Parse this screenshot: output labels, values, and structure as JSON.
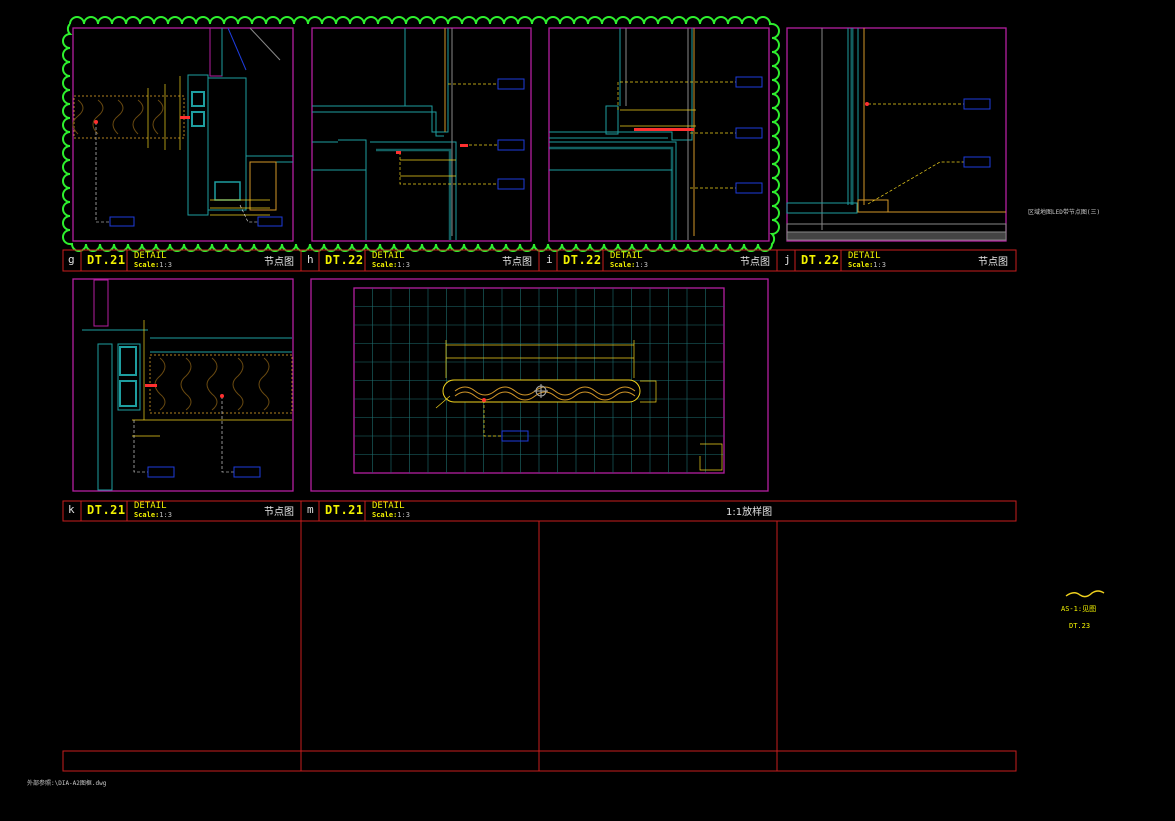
{
  "colors": {
    "background": "#000000",
    "frame_red": "#c81e1e",
    "viewport_magenta": "#b41ea0",
    "revision_cloud_green": "#2ef02e",
    "detail_cyan": "#1e9ea0",
    "dimension_yellow": "#f0d21e",
    "dimension_orange": "#d29628",
    "tag_blue": "#1e3cdc",
    "highlight_red": "#ff3030"
  },
  "details": [
    {
      "letter": "g",
      "ref": "DT.21",
      "detail": "DETAIL",
      "scale_label": "Scale:",
      "scale": "1:3",
      "name": "节点图"
    },
    {
      "letter": "h",
      "ref": "DT.22",
      "detail": "DETAIL",
      "scale_label": "Scale:",
      "scale": "1:3",
      "name": "节点图"
    },
    {
      "letter": "i",
      "ref": "DT.22",
      "detail": "DETAIL",
      "scale_label": "Scale:",
      "scale": "1:3",
      "name": "节点图"
    },
    {
      "letter": "j",
      "ref": "DT.22",
      "detail": "DETAIL",
      "scale_label": "Scale:",
      "scale": "1:3",
      "name": "节点图"
    },
    {
      "letter": "k",
      "ref": "DT.21",
      "detail": "DETAIL",
      "scale_label": "Scale:",
      "scale": "1:3",
      "name": "节点图"
    },
    {
      "letter": "m",
      "ref": "DT.21",
      "detail": "DETAIL",
      "scale_label": "Scale:",
      "scale": "1:3",
      "name": "1:1放样图"
    }
  ],
  "notes": {
    "side_note": "区域地图LED带节点图(三)",
    "side_ref_1": "AS-1:见图",
    "side_ref_2": "DT.23",
    "file_path": "外部参照:\\DIA-A2图框.dwg"
  }
}
